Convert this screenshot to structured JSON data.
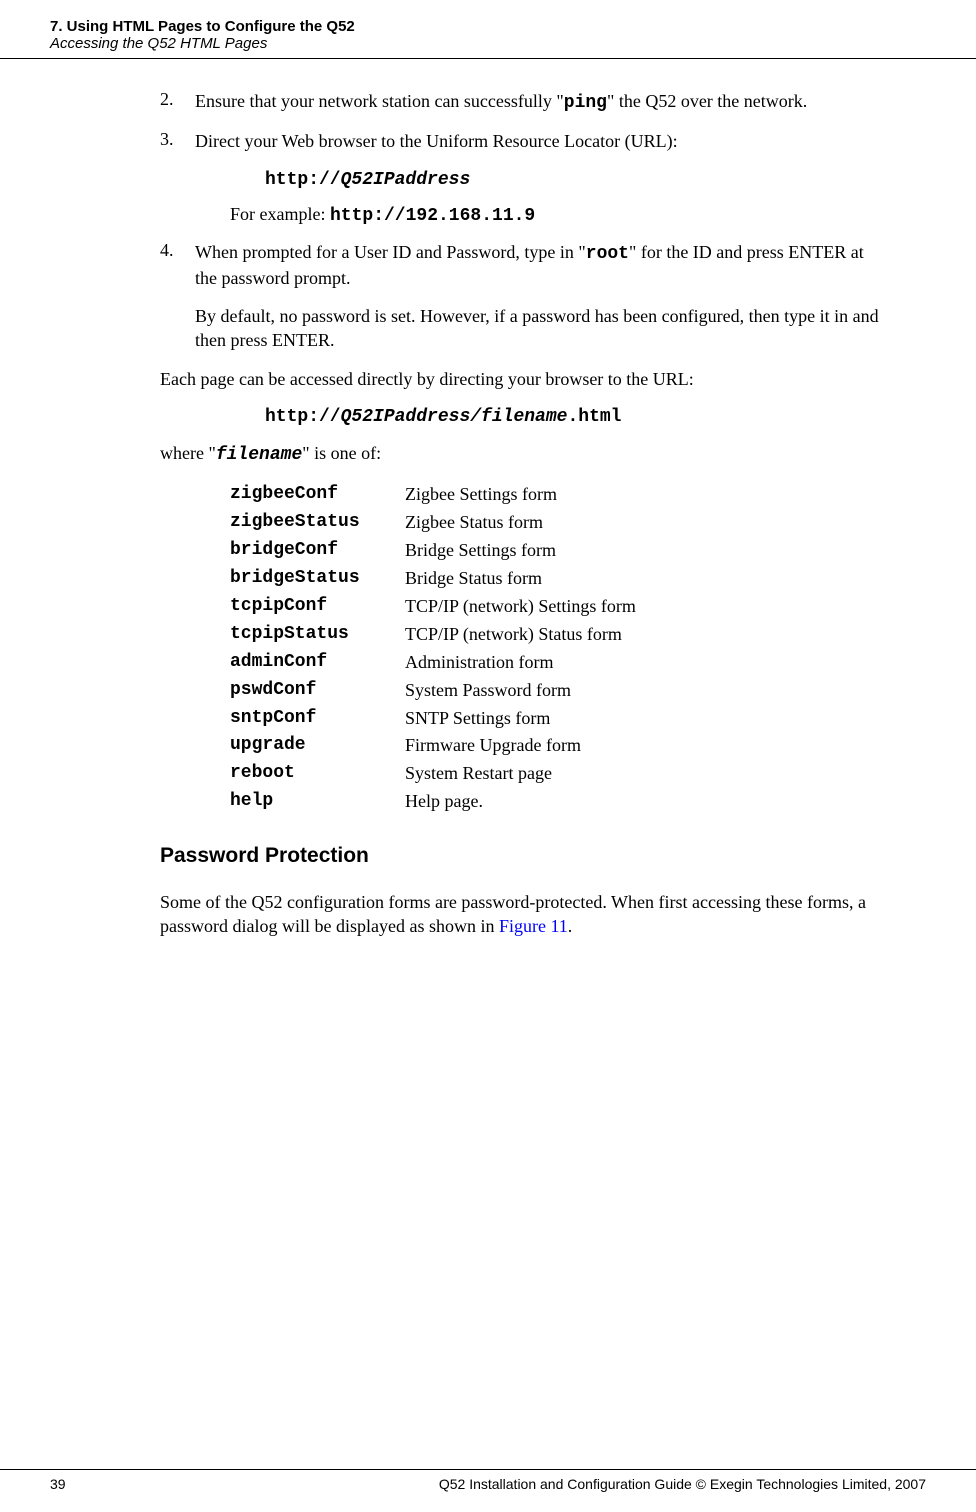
{
  "header": {
    "line1": "7. Using HTML Pages to Configure the Q52",
    "line2": "Accessing the Q52 HTML Pages"
  },
  "items": {
    "num2": "2.",
    "body2a": "Ensure that your network station can successfully \"",
    "body2b": "ping",
    "body2c": "\" the Q52 over the network.",
    "num3": "3.",
    "body3": "Direct your Web browser to the Uniform Resource Locator (URL):",
    "url3a": "http://",
    "url3b": "Q52IPaddress",
    "ex3a": "For example: ",
    "ex3b": "http://192.168.11.9",
    "num4": "4.",
    "body4a": "When prompted for a User ID and Password, type in \"",
    "body4b": "root",
    "body4c": "\" for the ID and press ENTER at the password prompt.",
    "body4d": "By default, no password is set. However, if a password has been configured, then type it in and then press ENTER."
  },
  "para1": "Each page can be accessed directly by directing your browser to the URL:",
  "url2a": "http://",
  "url2b": "Q52IPaddress/filename",
  "url2c": ".html",
  "para2a": "where \"",
  "para2b": "filename",
  "para2c": "\" is one of:",
  "files": {
    "k0": "zigbeeConf",
    "v0": "Zigbee Settings form",
    "k1": "zigbeeStatus",
    "v1": "Zigbee Status form",
    "k2": "bridgeConf",
    "v2": "Bridge Settings form",
    "k3": "bridgeStatus",
    "v3": "Bridge Status form",
    "k4": "tcpipConf",
    "v4": "TCP/IP (network) Settings form",
    "k5": "tcpipStatus",
    "v5": "TCP/IP (network) Status form",
    "k6": "adminConf",
    "v6": "Administration form",
    "k7": "pswdConf",
    "v7": "System Password form",
    "k8": "sntpConf",
    "v8": "SNTP Settings form",
    "k9": "upgrade",
    "v9": "Firmware Upgrade form",
    "k10": "reboot",
    "v10": "System Restart page",
    "k11": "help",
    "v11": "Help page."
  },
  "subheading": "Password Protection",
  "para3a": "Some of the Q52 configuration forms are password-protected. When first accessing these forms, a password dialog will be displayed as shown in ",
  "para3b": "Figure 11",
  "para3c": ".",
  "footer": {
    "page": "39",
    "text": "Q52 Installation and Configuration Guide  © Exegin Technologies Limited, 2007"
  }
}
